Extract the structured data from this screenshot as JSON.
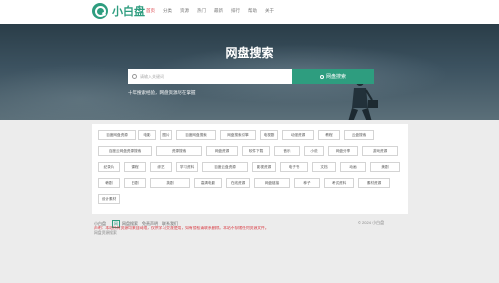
{
  "brand": {
    "name": "小白盘",
    "accent": "#2e9d7f"
  },
  "nav": {
    "items": [
      {
        "label": "首页",
        "active": true
      },
      {
        "label": "分类"
      },
      {
        "label": "资源"
      },
      {
        "label": "热门"
      },
      {
        "label": "最新"
      },
      {
        "label": "排行"
      },
      {
        "label": "帮助"
      },
      {
        "label": "关于"
      }
    ]
  },
  "hero": {
    "title": "网盘搜索",
    "search_placeholder": "请输入关键词",
    "search_button": "网盘搜索",
    "subtitle": "十年搜索经验，网盘资源尽在掌握"
  },
  "tags": [
    "百度网盘资源",
    "电影",
    "图片",
    "百度网盘搜索",
    "网盘搜索引擎",
    "电视剧",
    "动漫资源",
    "教程",
    "云盘搜索",
    "百度云网盘资源搜索",
    "资源搜索",
    "网盘资源",
    "软件下载",
    "音乐",
    "小说",
    "网盘分享",
    "游戏资源",
    "纪录片",
    "课程",
    "综艺",
    "学习资料",
    "百度云盘资源",
    "影视资源",
    "电子书",
    "文档",
    "动画",
    "美剧",
    "韩剧",
    "日剧",
    "英剧",
    "高清电影",
    "在线资源",
    "网盘链接",
    "种子",
    "考试资料",
    "素材资源",
    "设计素材"
  ],
  "footer": {
    "copyright": "小白盘",
    "badge": "网",
    "links": [
      "网盘搜索",
      "免责声明",
      "联系我们"
    ],
    "right": "© 2024 小白盘",
    "warning": "声明：本站所有资源均来自网络，仅供学习交流使用，如有侵权请联系删除。本站不存储任何资源文件。",
    "note": "网盘资源搜索"
  }
}
